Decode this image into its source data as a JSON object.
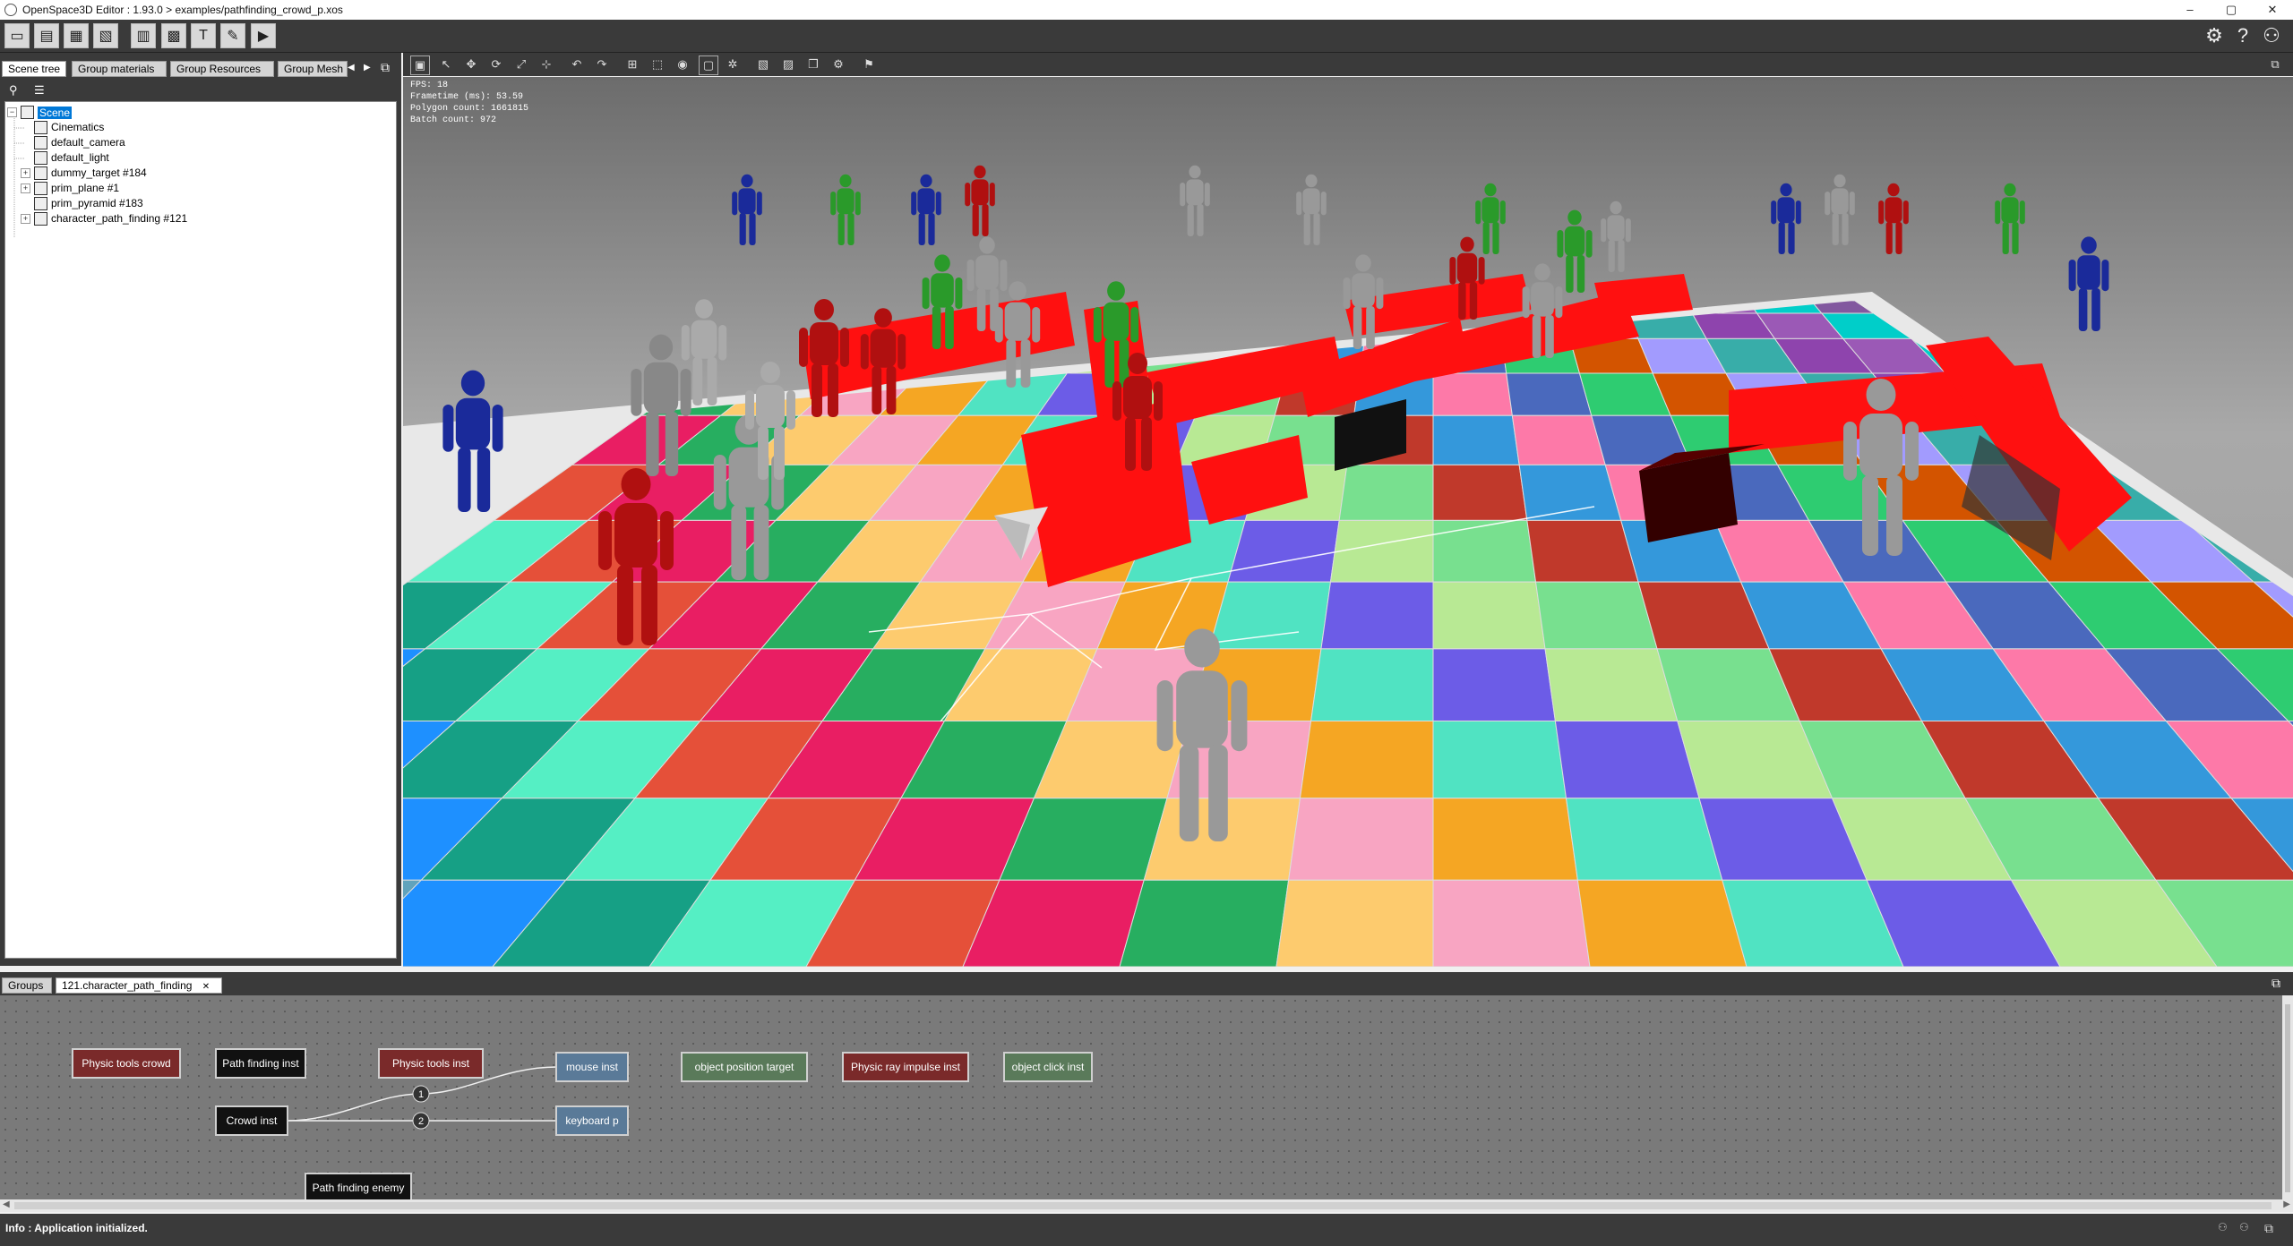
{
  "window": {
    "title": "OpenSpace3D Editor : 1.93.0 > examples/pathfinding_crowd_p.xos",
    "minimize": "–",
    "maximize": "▢",
    "close": "✕"
  },
  "toolbar": {
    "icons": [
      "new-scene-icon",
      "open-icon",
      "save-icon",
      "save-as-icon",
      "import-icon",
      "resources-icon",
      "text-icon",
      "tools-icon",
      "run-icon"
    ],
    "right_icons": [
      "settings-icon",
      "help-icon",
      "user-icon"
    ],
    "settings_glyph": "⚙",
    "help_glyph": "?",
    "user_glyph": "⚇"
  },
  "left_panel": {
    "tabs": [
      "Scene tree",
      "Group materials",
      "Group Resources",
      "Group Mesh"
    ],
    "prev": "◀",
    "next": "▶",
    "search_glyph": "⚲",
    "list_glyph": "☰"
  },
  "scene_tree": [
    {
      "label": "Scene",
      "expander": "−",
      "selected": true,
      "icon": "scene-node-icon"
    },
    {
      "label": "Cinematics",
      "expander": "",
      "icon": "cinematics-icon"
    },
    {
      "label": "default_camera",
      "expander": "",
      "icon": "camera-icon"
    },
    {
      "label": "default_light",
      "expander": "",
      "icon": "light-icon"
    },
    {
      "label": "dummy_target #184",
      "expander": "+",
      "icon": "dummy-node-icon"
    },
    {
      "label": "prim_plane #1",
      "expander": "+",
      "icon": "mesh-node-icon"
    },
    {
      "label": "prim_pyramid #183",
      "expander": "",
      "icon": "mesh-node-icon"
    },
    {
      "label": "character_path_finding #121",
      "expander": "+",
      "icon": "group-node-icon"
    }
  ],
  "viewport": {
    "stats": [
      "FPS: 18",
      "Frametime (ms): 53.59",
      "Polygon count: 1661815",
      "Batch count: 972"
    ]
  },
  "bottom": {
    "tabs": [
      "Groups",
      "121.character_path_finding"
    ],
    "tab_close": "✕",
    "nodes": [
      {
        "label": "Physic tools crowd",
        "style": "red"
      },
      {
        "label": "Path finding inst",
        "style": "black"
      },
      {
        "label": "Physic tools inst",
        "style": "red"
      },
      {
        "label": "mouse inst",
        "style": "blue"
      },
      {
        "label": "object position target",
        "style": "green"
      },
      {
        "label": "Physic ray impulse inst",
        "style": "red"
      },
      {
        "label": "object click inst",
        "style": "green"
      },
      {
        "label": "Crowd inst",
        "style": "black"
      },
      {
        "label": "keyboard p",
        "style": "blue"
      },
      {
        "label": "Path finding enemy",
        "style": "black"
      }
    ],
    "link_labels": [
      "1",
      "2"
    ]
  },
  "status": {
    "message": "Info : Application initialized."
  }
}
